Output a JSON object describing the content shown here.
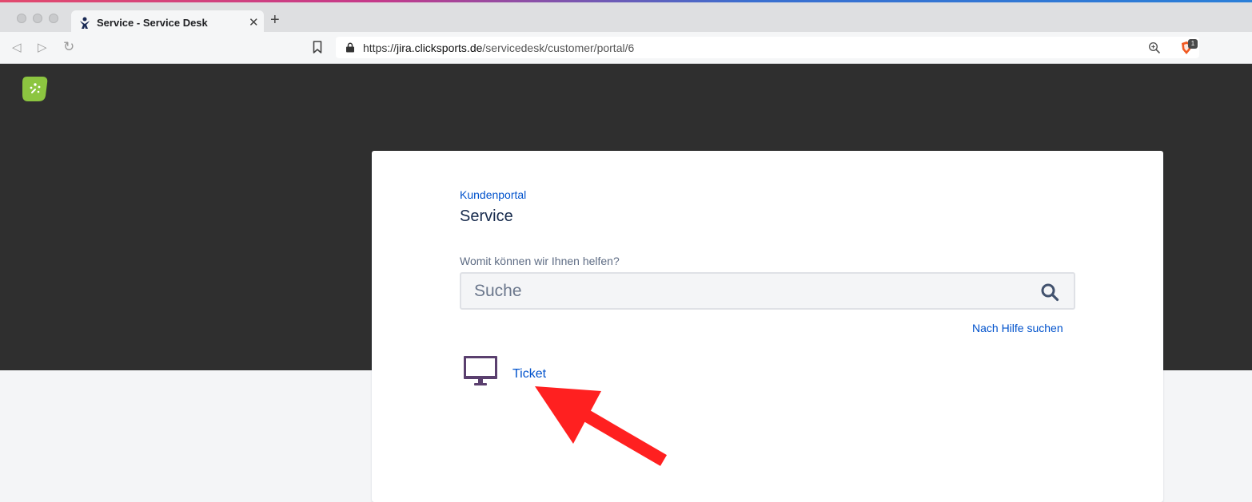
{
  "browser": {
    "tab": {
      "title": "Service - Service Desk",
      "close_glyph": "✕"
    },
    "new_tab_glyph": "+",
    "nav": {
      "back_glyph": "◁",
      "forward_glyph": "▷",
      "reload_glyph": "↻"
    },
    "url": {
      "scheme": "https://",
      "domain": "jira.clicksports.de",
      "path": "/servicedesk/customer/portal/6"
    },
    "shields_count": "1"
  },
  "portal": {
    "breadcrumb": "Kundenportal",
    "title": "Service",
    "search": {
      "label": "Womit können wir Ihnen helfen?",
      "placeholder": "Suche"
    },
    "help_link": "Nach Hilfe suchen",
    "request_types": [
      {
        "label": "Ticket",
        "icon": "monitor-icon"
      }
    ]
  },
  "colors": {
    "hero": "#2f2f2f",
    "link": "#0052cc",
    "logo": "#8cc540",
    "monitor": "#5a3f6e",
    "arrow": "#ff2020"
  }
}
